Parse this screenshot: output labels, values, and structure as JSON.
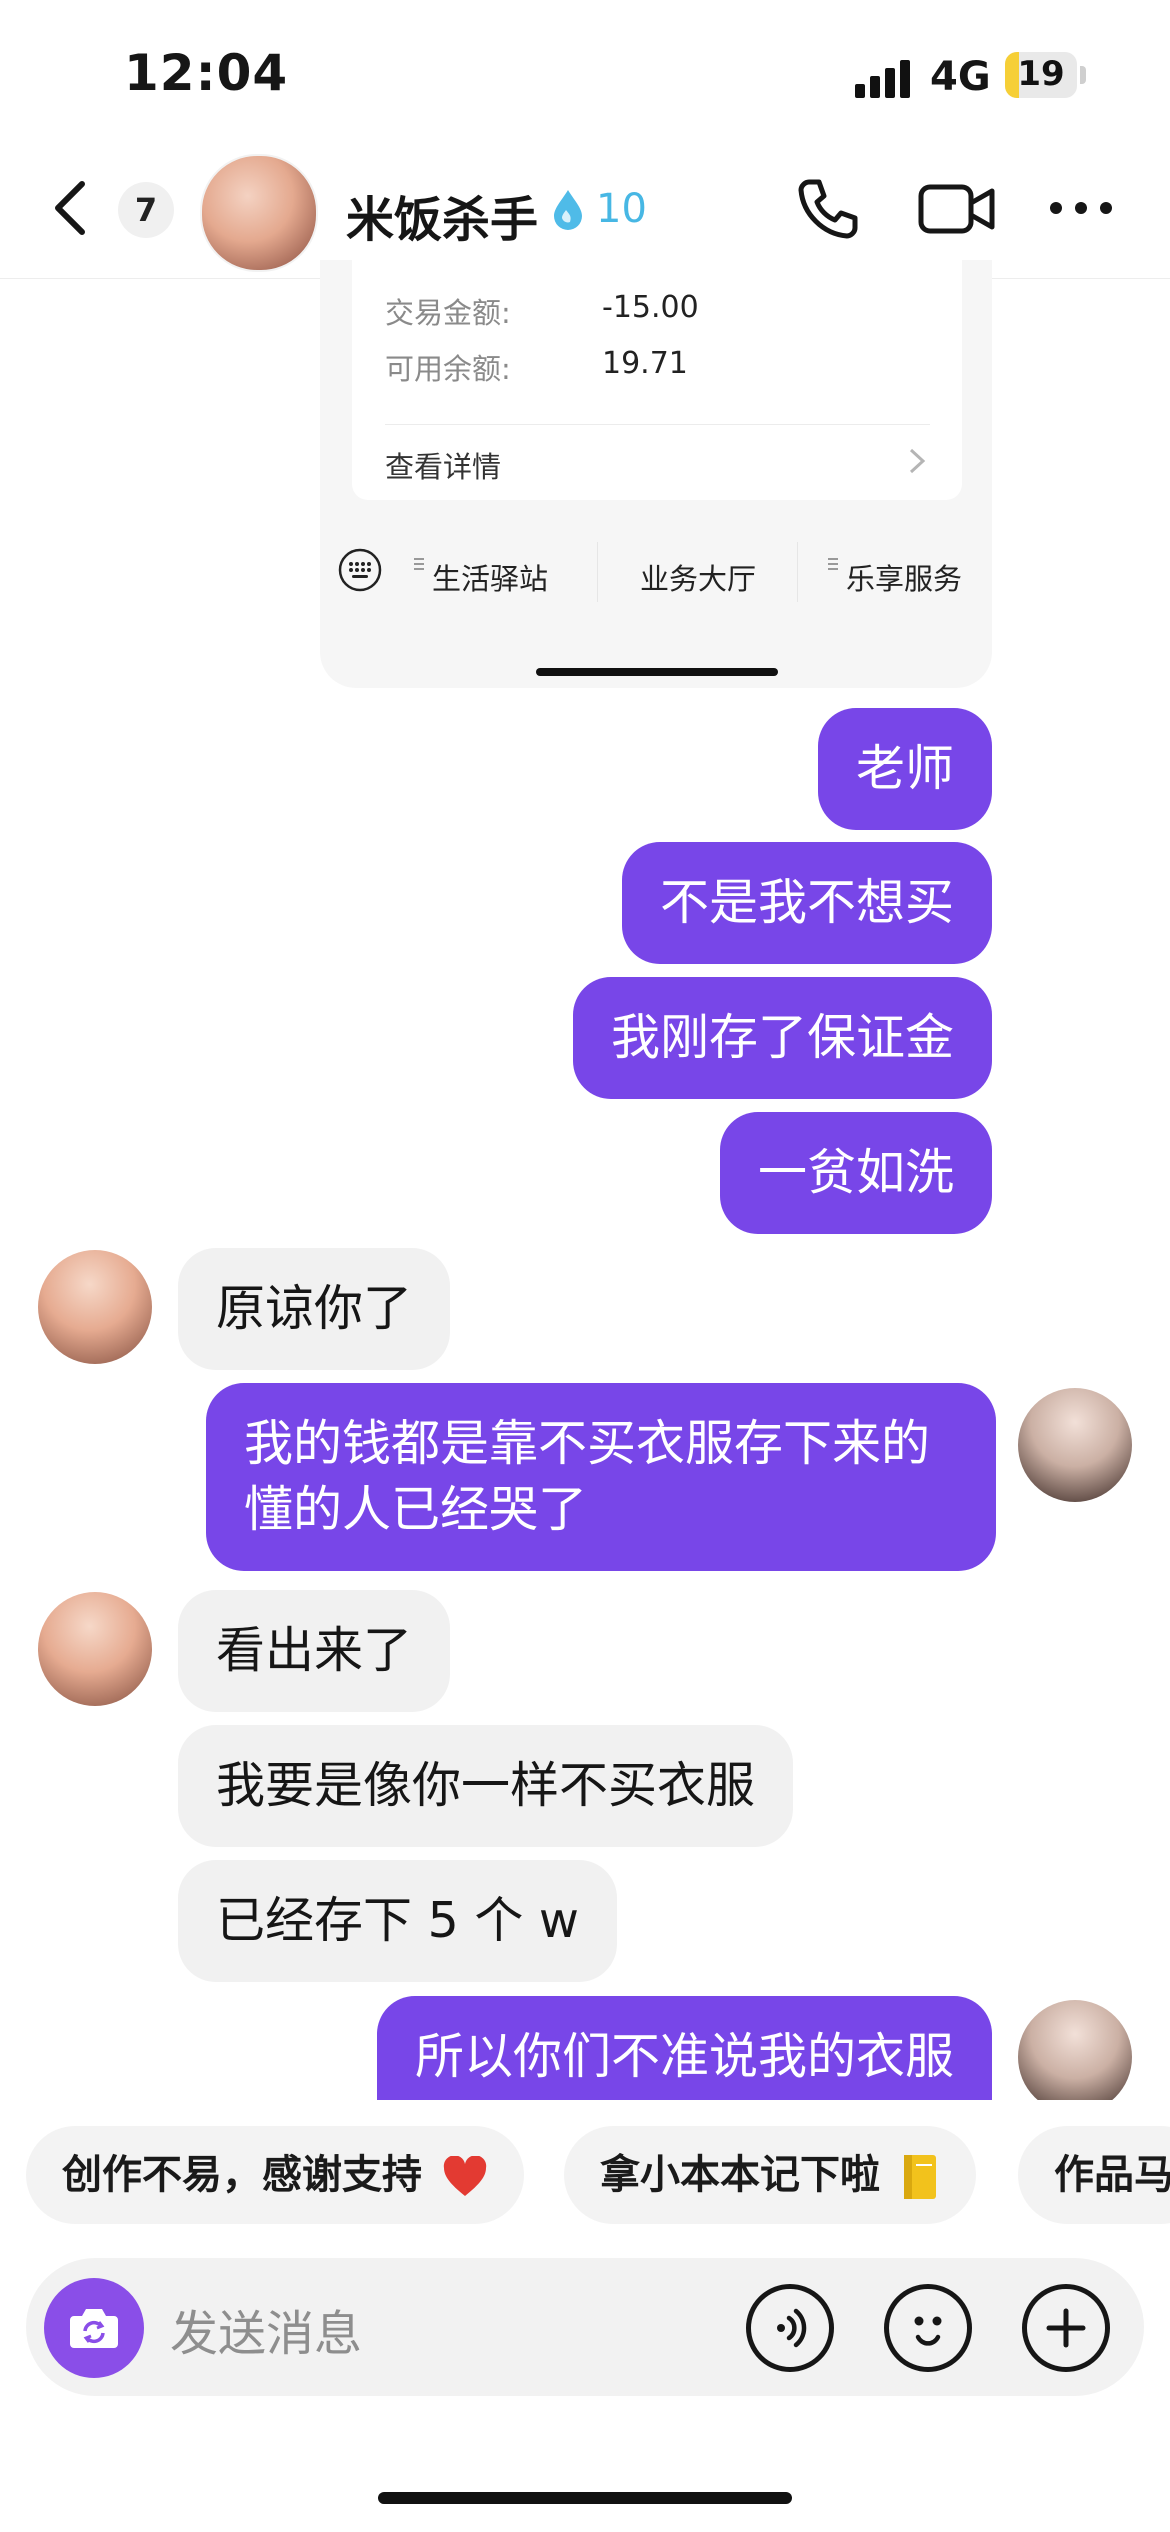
{
  "status_bar": {
    "time": "12:04",
    "network": "4G",
    "battery": "19",
    "battery_fraction": 0.19
  },
  "header": {
    "unread_count": "7",
    "contact_name": "米饭杀手",
    "streak": "10"
  },
  "card": {
    "rows": [
      {
        "label": "交易金额:",
        "value": "-15.00"
      },
      {
        "label": "可用余额:",
        "value": "19.71"
      }
    ],
    "detail_link": "查看详情",
    "menu": [
      "生活驿站",
      "业务大厅",
      "乐享服务"
    ]
  },
  "messages": [
    {
      "dir": "out",
      "text": "老师"
    },
    {
      "dir": "out",
      "text": "不是我不想买"
    },
    {
      "dir": "out",
      "text": "我刚存了保证金"
    },
    {
      "dir": "out",
      "text": "一贫如洗"
    },
    {
      "dir": "in",
      "text": "原谅你了"
    },
    {
      "dir": "out",
      "text": "我的钱都是靠不买衣服存下来的 懂的人已经哭了"
    },
    {
      "dir": "in",
      "text": "看出来了"
    },
    {
      "dir": "in",
      "text": "我要是像你一样不买衣服"
    },
    {
      "dir": "in",
      "text": "已经存下 5 个 w"
    },
    {
      "dir": "out",
      "text": "所以你们不准说我的衣服"
    }
  ],
  "quick_replies": [
    "创作不易，感谢支持",
    "拿小本本记下啦",
    "作品马"
  ],
  "input": {
    "placeholder": "发送消息"
  },
  "colors": {
    "accent": "#7846e8",
    "incoming": "#f1f1f1",
    "streak": "#47b7e4",
    "camera": "#8a4ee8"
  }
}
